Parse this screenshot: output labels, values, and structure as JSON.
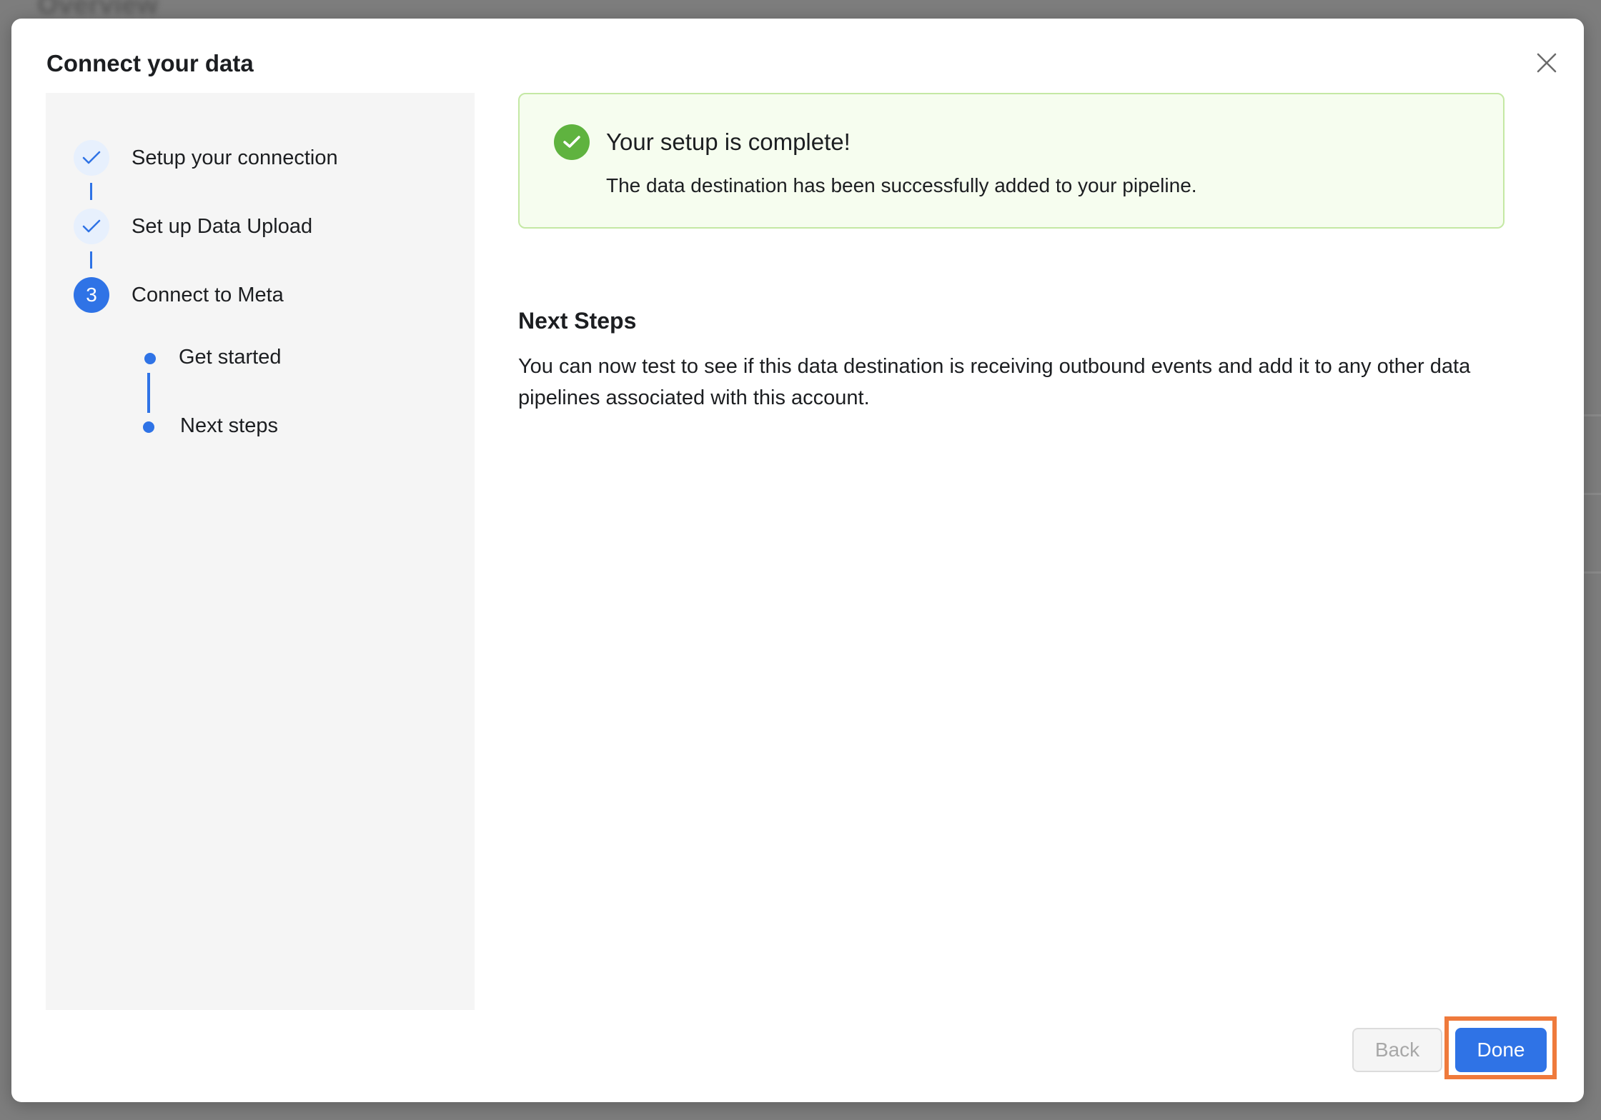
{
  "backdrop": {
    "title": "Overview"
  },
  "modal": {
    "title": "Connect your data",
    "close_icon": "close-icon"
  },
  "stepper": {
    "steps": [
      {
        "label": "Setup your connection",
        "state": "complete",
        "icon": "check-icon"
      },
      {
        "label": "Set up Data Upload",
        "state": "complete",
        "icon": "check-icon"
      },
      {
        "label": "Connect to Meta",
        "state": "active",
        "number": "3"
      }
    ],
    "substeps": [
      {
        "label": "Get started"
      },
      {
        "label": "Next steps"
      }
    ]
  },
  "banner": {
    "icon": "check-circle-icon",
    "title": "Your setup is complete!",
    "description": "The data destination has been successfully added to your pipeline."
  },
  "next_steps": {
    "heading": "Next Steps",
    "body": "You can now test to see if this data destination is receiving outbound events and add it to any other data pipelines associated with this account."
  },
  "footer": {
    "back_label": "Back",
    "done_label": "Done"
  },
  "colors": {
    "accent": "#2f73e6",
    "success": "#5fb33f",
    "highlight": "#ef7a3c"
  }
}
